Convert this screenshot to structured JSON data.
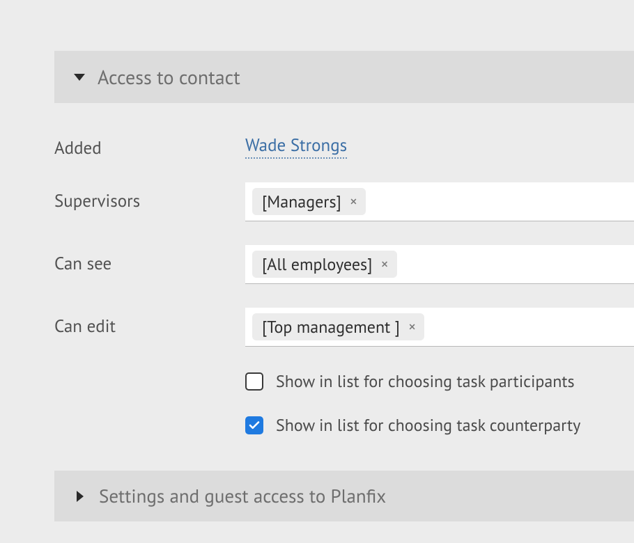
{
  "sections": {
    "access": {
      "title": "Access to contact"
    },
    "settings": {
      "title": "Settings and guest access to Planfix"
    }
  },
  "fields": {
    "added": {
      "label": "Added",
      "user": "Wade Strongs"
    },
    "supervisors": {
      "label": "Supervisors",
      "tags": [
        "[Managers]"
      ]
    },
    "can_see": {
      "label": "Can see",
      "tags": [
        "[All employees]"
      ]
    },
    "can_edit": {
      "label": "Can edit",
      "tags": [
        "[Top management ]"
      ]
    }
  },
  "checkboxes": {
    "participants": {
      "label": "Show in list for choosing task participants",
      "checked": false
    },
    "counterparty": {
      "label": "Show in list for choosing task counterparty",
      "checked": true
    }
  }
}
